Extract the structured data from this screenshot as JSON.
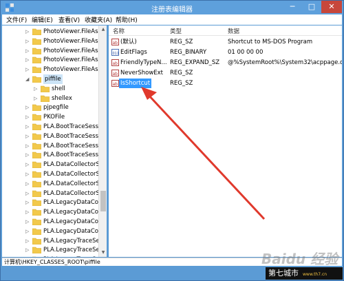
{
  "window": {
    "title": "注册表编辑器",
    "min_glyph": "─",
    "max_glyph": "□",
    "close_glyph": "✕"
  },
  "menu": [
    "文件(F)",
    "编辑(E)",
    "查看(V)",
    "收藏夹(A)",
    "帮助(H)"
  ],
  "tree": [
    {
      "label": "PhotoViewer.FileAss",
      "expander": "▷"
    },
    {
      "label": "PhotoViewer.FileAss",
      "expander": "▷"
    },
    {
      "label": "PhotoViewer.FileAss",
      "expander": "▷"
    },
    {
      "label": "PhotoViewer.FileAss",
      "expander": "▷"
    },
    {
      "label": "PhotoViewer.FileAss",
      "expander": "▷"
    },
    {
      "label": "piffile",
      "expander": "◢",
      "selected": true
    },
    {
      "label": "shell",
      "expander": "▷",
      "child": true
    },
    {
      "label": "shellex",
      "expander": "▷",
      "child": true
    },
    {
      "label": "pjpegfile",
      "expander": "▷"
    },
    {
      "label": "PKOFile",
      "expander": "▷"
    },
    {
      "label": "PLA.BootTraceSessi",
      "expander": "▷"
    },
    {
      "label": "PLA.BootTraceSessi",
      "expander": "▷"
    },
    {
      "label": "PLA.BootTraceSessi",
      "expander": "▷"
    },
    {
      "label": "PLA.BootTraceSessi",
      "expander": "▷"
    },
    {
      "label": "PLA.DataCollectorSe",
      "expander": "▷"
    },
    {
      "label": "PLA.DataCollectorSe",
      "expander": "▷"
    },
    {
      "label": "PLA.DataCollectorSe",
      "expander": "▷"
    },
    {
      "label": "PLA.DataCollectorSe",
      "expander": "▷"
    },
    {
      "label": "PLA.LegacyDataColl",
      "expander": "▷"
    },
    {
      "label": "PLA.LegacyDataColl",
      "expander": "▷"
    },
    {
      "label": "PLA.LegacyDataColl",
      "expander": "▷"
    },
    {
      "label": "PLA.LegacyDataColl",
      "expander": "▷"
    },
    {
      "label": "PLA.LegacyTraceSes",
      "expander": "▷"
    },
    {
      "label": "PLA.LegacyTraceSes",
      "expander": "▷"
    },
    {
      "label": "PLA.LegacyTraceSes",
      "expander": "▷"
    }
  ],
  "scroll": {
    "up": "▲",
    "down": "▼"
  },
  "list_columns": [
    "名称",
    "类型",
    "数据"
  ],
  "list_rows": [
    {
      "icon": "string-value-icon",
      "name": "(默认)",
      "type": "REG_SZ",
      "data": "Shortcut to MS-DOS Program"
    },
    {
      "icon": "binary-value-icon",
      "name": "EditFlags",
      "type": "REG_BINARY",
      "data": "01 00 00 00"
    },
    {
      "icon": "string-value-icon",
      "name": "FriendlyTypeN...",
      "type": "REG_EXPAND_SZ",
      "data": "@%SystemRoot%\\System32\\acppage.dll"
    },
    {
      "icon": "string-value-icon",
      "name": "NeverShowExt",
      "type": "REG_SZ",
      "data": ""
    },
    {
      "icon": "string-value-icon",
      "name": "IsShortcut",
      "type": "REG_SZ",
      "data": "",
      "selected": true
    }
  ],
  "status": {
    "path": "计算机\\HKEY_CLASSES_ROOT\\piffile"
  },
  "branding": {
    "watermark": "Baidu 经验",
    "logo": "第七城市",
    "logo_sub": "www.th7.cn"
  },
  "colors": {
    "titlebar": "#5ea0dc",
    "close": "#c7473b",
    "selection": "#3399ff",
    "arrow": "#e0392c"
  }
}
